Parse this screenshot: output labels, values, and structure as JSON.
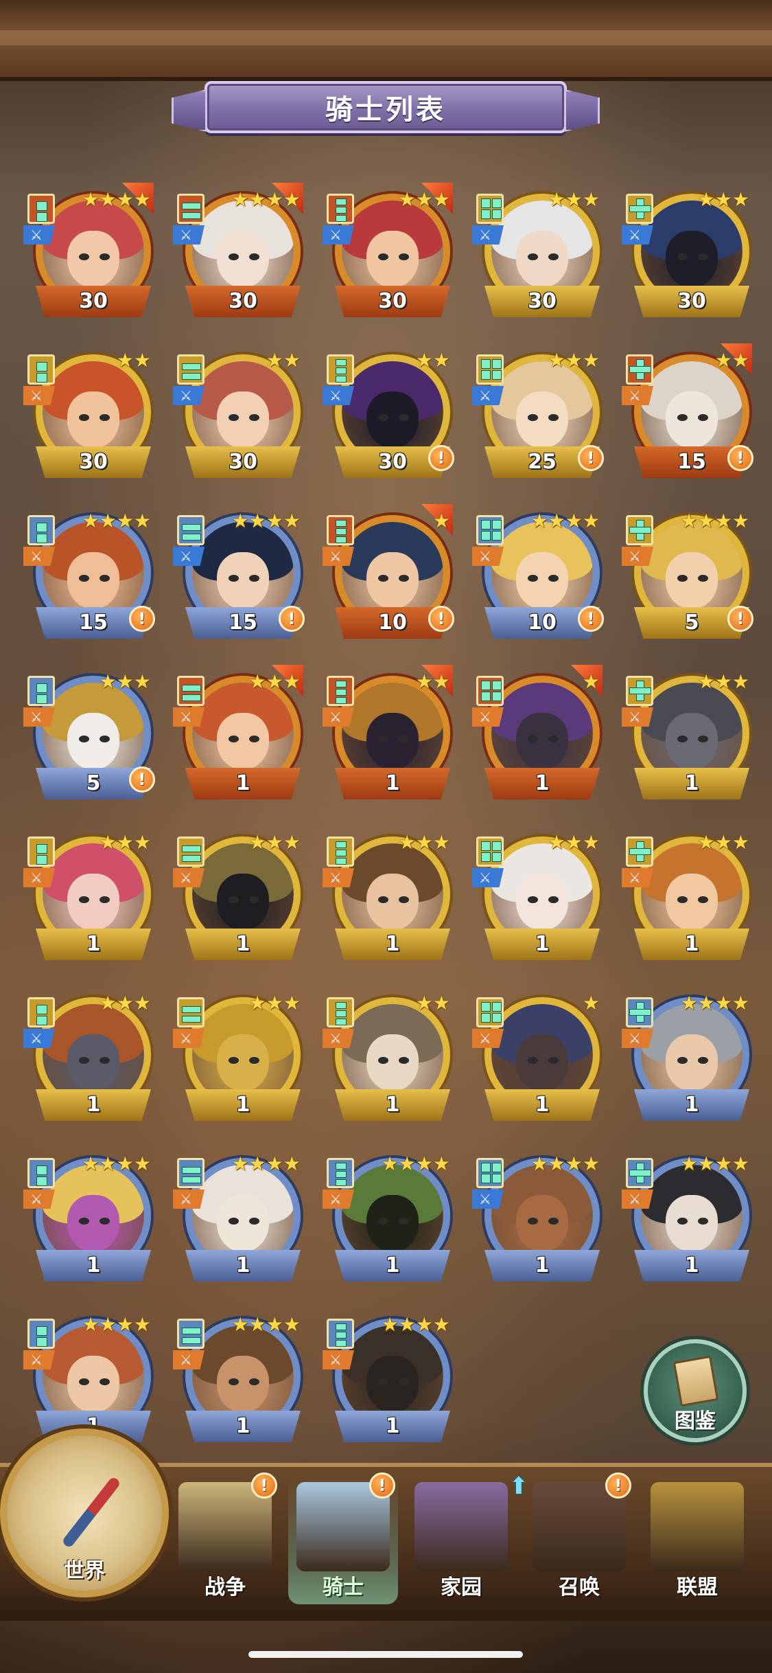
{
  "header": {
    "title": "骑士列表"
  },
  "knights": [
    {
      "level": "30",
      "stars": 4,
      "frame": "red",
      "flag": true,
      "alert": false,
      "badge": "c-red",
      "weapon": "w-blue",
      "hair": "#c74a4a",
      "skin": "#f2c9a8"
    },
    {
      "level": "30",
      "stars": 4,
      "frame": "red",
      "flag": true,
      "alert": false,
      "badge": "c-red",
      "weapon": "w-blue",
      "hair": "#e8e2dc",
      "skin": "#f1e0d2"
    },
    {
      "level": "30",
      "stars": 3,
      "frame": "red",
      "flag": true,
      "alert": false,
      "badge": "c-red",
      "weapon": "w-blue",
      "hair": "#b83a3a",
      "skin": "#f0c6a2"
    },
    {
      "level": "30",
      "stars": 3,
      "frame": "gold",
      "flag": false,
      "alert": false,
      "badge": "c-gold",
      "weapon": "w-blue",
      "hair": "#e5e5e5",
      "skin": "#efd9c6"
    },
    {
      "level": "30",
      "stars": 3,
      "frame": "gold",
      "flag": false,
      "alert": false,
      "badge": "c-gold",
      "weapon": "w-blue",
      "hair": "#2b3b6a",
      "skin": "#1e1e2a"
    },
    {
      "level": "30",
      "stars": 2,
      "frame": "gold",
      "flag": false,
      "alert": false,
      "badge": "c-gold",
      "weapon": "w-orange",
      "hair": "#c9542a",
      "skin": "#f1c39a"
    },
    {
      "level": "30",
      "stars": 2,
      "frame": "gold",
      "flag": false,
      "alert": false,
      "badge": "c-gold",
      "weapon": "w-blue",
      "hair": "#b85a4a",
      "skin": "#f3cfb4"
    },
    {
      "level": "30",
      "stars": 2,
      "frame": "gold",
      "flag": false,
      "alert": true,
      "badge": "c-gold",
      "weapon": "w-blue",
      "hair": "#4a2a6a",
      "skin": "#1c1c28"
    },
    {
      "level": "25",
      "stars": 3,
      "frame": "gold",
      "flag": false,
      "alert": true,
      "badge": "c-gold",
      "weapon": "w-blue",
      "hair": "#e4c79a",
      "skin": "#f4dcc2"
    },
    {
      "level": "15",
      "stars": 2,
      "frame": "red",
      "flag": true,
      "alert": true,
      "badge": "c-red",
      "weapon": "w-orange",
      "hair": "#dcd4c8",
      "skin": "#eee6da"
    },
    {
      "level": "15",
      "stars": 4,
      "frame": "blue",
      "flag": false,
      "alert": true,
      "badge": "c-blue",
      "weapon": "w-orange",
      "hair": "#b85428",
      "skin": "#f0be96"
    },
    {
      "level": "15",
      "stars": 4,
      "frame": "blue",
      "flag": false,
      "alert": true,
      "badge": "c-blue",
      "weapon": "w-blue",
      "hair": "#1e2a44",
      "skin": "#f0d2b8"
    },
    {
      "level": "10",
      "stars": 1,
      "frame": "red",
      "flag": true,
      "alert": true,
      "badge": "c-red",
      "weapon": "w-orange",
      "hair": "#2a3a5a",
      "skin": "#efc7a4"
    },
    {
      "level": "10",
      "stars": 4,
      "frame": "blue",
      "flag": false,
      "alert": true,
      "badge": "c-blue",
      "weapon": "w-orange",
      "hair": "#e8c25a",
      "skin": "#f3d3b0"
    },
    {
      "level": "5",
      "stars": 4,
      "frame": "gold",
      "flag": false,
      "alert": true,
      "badge": "c-gold",
      "weapon": "w-orange",
      "hair": "#e0b850",
      "skin": "#f2d0ac"
    },
    {
      "level": "5",
      "stars": 3,
      "frame": "blue",
      "flag": false,
      "alert": true,
      "badge": "c-blue",
      "weapon": "w-orange",
      "hair": "#c49a3a",
      "skin": "#f0ece8"
    },
    {
      "level": "1",
      "stars": 3,
      "frame": "red",
      "flag": true,
      "alert": false,
      "badge": "c-red",
      "weapon": "w-orange",
      "hair": "#c8582e",
      "skin": "#f2c8a4"
    },
    {
      "level": "1",
      "stars": 2,
      "frame": "red",
      "flag": true,
      "alert": false,
      "badge": "c-red",
      "weapon": "w-orange",
      "hair": "#b0762a",
      "skin": "#2a2230"
    },
    {
      "level": "1",
      "stars": 1,
      "frame": "red",
      "flag": true,
      "alert": false,
      "badge": "c-red",
      "weapon": "w-orange",
      "hair": "#5a3a7a",
      "skin": "#3a3240"
    },
    {
      "level": "1",
      "stars": 3,
      "frame": "gold",
      "flag": false,
      "alert": false,
      "badge": "c-gold",
      "weapon": "w-orange",
      "hair": "#4a4a52",
      "skin": "#6a6a72"
    },
    {
      "level": "1",
      "stars": 3,
      "frame": "gold",
      "flag": false,
      "alert": false,
      "badge": "c-gold",
      "weapon": "w-orange",
      "hair": "#d0506a",
      "skin": "#f2ccc0"
    },
    {
      "level": "1",
      "stars": 3,
      "frame": "gold",
      "flag": false,
      "alert": false,
      "badge": "c-gold",
      "weapon": "w-orange",
      "hair": "#7a6a3a",
      "skin": "#1e1e22"
    },
    {
      "level": "1",
      "stars": 3,
      "frame": "gold",
      "flag": false,
      "alert": false,
      "badge": "c-gold",
      "weapon": "w-orange",
      "hair": "#6a4a2a",
      "skin": "#e9c3a0"
    },
    {
      "level": "1",
      "stars": 3,
      "frame": "gold",
      "flag": false,
      "alert": false,
      "badge": "c-gold",
      "weapon": "w-blue",
      "hair": "#eae6e2",
      "skin": "#f3e4dc"
    },
    {
      "level": "1",
      "stars": 3,
      "frame": "gold",
      "flag": false,
      "alert": false,
      "badge": "c-gold",
      "weapon": "w-orange",
      "hair": "#c6732e",
      "skin": "#f2c8a0"
    },
    {
      "level": "1",
      "stars": 3,
      "frame": "gold",
      "flag": false,
      "alert": false,
      "badge": "c-gold",
      "weapon": "w-blue",
      "hair": "#a8552a",
      "skin": "#5a5a68"
    },
    {
      "level": "1",
      "stars": 3,
      "frame": "gold",
      "flag": false,
      "alert": false,
      "badge": "c-gold",
      "weapon": "w-orange",
      "hair": "#c79a2c",
      "skin": "#d8b04a"
    },
    {
      "level": "1",
      "stars": 2,
      "frame": "gold",
      "flag": false,
      "alert": false,
      "badge": "c-gold",
      "weapon": "w-orange",
      "hair": "#7a6a56",
      "skin": "#e8d8c4"
    },
    {
      "level": "1",
      "stars": 1,
      "frame": "gold",
      "flag": false,
      "alert": false,
      "badge": "c-gold",
      "weapon": "w-orange",
      "hair": "#3a4068",
      "skin": "#4a3a3a"
    },
    {
      "level": "1",
      "stars": 4,
      "frame": "blue",
      "flag": false,
      "alert": false,
      "badge": "c-blue",
      "weapon": "w-orange",
      "hair": "#9aa0a6",
      "skin": "#e9c9aa"
    },
    {
      "level": "1",
      "stars": 4,
      "frame": "blue",
      "flag": false,
      "alert": false,
      "badge": "c-blue",
      "weapon": "w-orange",
      "hair": "#e6c25a",
      "skin": "#b25ab0"
    },
    {
      "level": "1",
      "stars": 4,
      "frame": "blue",
      "flag": false,
      "alert": false,
      "badge": "c-blue",
      "weapon": "w-orange",
      "hair": "#e8e2d8",
      "skin": "#efe6da"
    },
    {
      "level": "1",
      "stars": 4,
      "frame": "blue",
      "flag": false,
      "alert": false,
      "badge": "c-blue",
      "weapon": "w-orange",
      "hair": "#5a7a3a",
      "skin": "#1e2218"
    },
    {
      "level": "1",
      "stars": 4,
      "frame": "blue",
      "flag": false,
      "alert": false,
      "badge": "c-blue",
      "weapon": "w-blue",
      "hair": "#8a5a3a",
      "skin": "#a86a42"
    },
    {
      "level": "1",
      "stars": 4,
      "frame": "blue",
      "flag": false,
      "alert": false,
      "badge": "c-blue",
      "weapon": "w-orange",
      "hair": "#2c2c30",
      "skin": "#e9dcd0"
    },
    {
      "level": "1",
      "stars": 4,
      "frame": "blue",
      "flag": false,
      "alert": false,
      "badge": "c-blue",
      "weapon": "w-orange",
      "hair": "#b85a34",
      "skin": "#eec8a6"
    },
    {
      "level": "1",
      "stars": 4,
      "frame": "blue",
      "flag": false,
      "alert": false,
      "badge": "c-blue",
      "weapon": "w-orange",
      "hair": "#6a4a2a",
      "skin": "#c8926a"
    },
    {
      "level": "1",
      "stars": 4,
      "frame": "blue",
      "flag": false,
      "alert": false,
      "badge": "c-blue",
      "weapon": "w-orange",
      "hair": "#3a3028",
      "skin": "#2a2420"
    }
  ],
  "book": {
    "label": "图鉴"
  },
  "nav": {
    "world": "世界",
    "tabs": [
      {
        "label": "战争",
        "alert": true,
        "active": false,
        "art": "#cdb57a"
      },
      {
        "label": "骑士",
        "alert": true,
        "active": true,
        "art": "#aac8e0"
      },
      {
        "label": "家园",
        "alert": false,
        "active": false,
        "art": "#8a6aa0"
      },
      {
        "label": "召唤",
        "alert": true,
        "active": false,
        "art": "#6a4a3a"
      },
      {
        "label": "联盟",
        "alert": false,
        "active": false,
        "art": "#b8923c"
      }
    ]
  },
  "icons": {
    "alert": "!",
    "star": "★",
    "up_arrow": "⬆",
    "weapon_glyph": "⚔"
  }
}
